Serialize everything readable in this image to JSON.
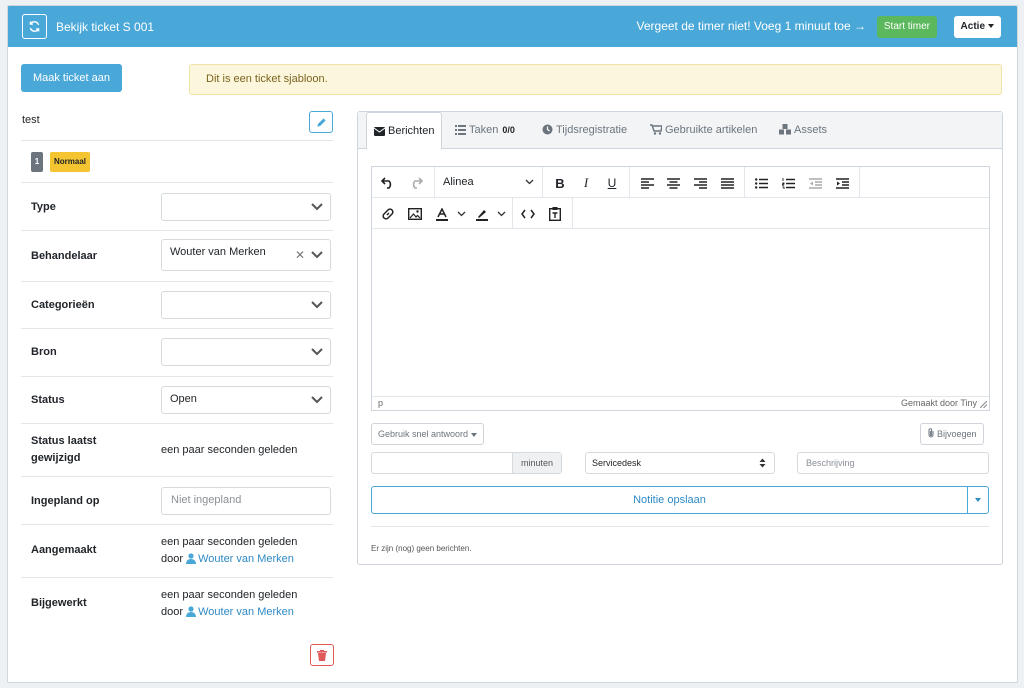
{
  "topbar": {
    "title": "Bekijk ticket S 001",
    "timer_message": "Vergeet de timer niet! Voeg 1 minuut toe →",
    "start_timer": "Start timer",
    "actie": "Actie"
  },
  "create_ticket": "Maak ticket aan",
  "alert": "Dit is een ticket sjabloon.",
  "ticket": {
    "name": "test",
    "number_badge": "1",
    "priority_badge": "Normaal"
  },
  "fields": {
    "type": {
      "label": "Type",
      "value": ""
    },
    "behandelaar": {
      "label": "Behandelaar",
      "value": "Wouter van Merken"
    },
    "categorieen": {
      "label": "Categorieën",
      "value": ""
    },
    "bron": {
      "label": "Bron",
      "value": ""
    },
    "status": {
      "label": "Status",
      "value": "Open"
    },
    "status_changed": {
      "label_1": "Status laatst",
      "label_2": "gewijzigd",
      "value": "een paar seconden geleden"
    },
    "ingepland": {
      "label": "Ingepland op",
      "placeholder": "Niet ingepland"
    },
    "aangemaakt": {
      "label": "Aangemaakt",
      "value": "een paar seconden geleden",
      "by": "door",
      "user": "Wouter van Merken"
    },
    "bijgewerkt": {
      "label": "Bijgewerkt",
      "value": "een paar seconden geleden",
      "by": "door",
      "user": "Wouter van Merken"
    }
  },
  "tabs": [
    {
      "label": "Berichten"
    },
    {
      "label": "Taken",
      "count": "0/0"
    },
    {
      "label": "Tijdsregistratie"
    },
    {
      "label": "Gebruikte artikelen"
    },
    {
      "label": "Assets"
    }
  ],
  "editor": {
    "block_format": "Alinea",
    "status_path": "p",
    "made_by": "Gemaakt door Tiny"
  },
  "quick_reply": "Gebruik snel antwoord",
  "attach": "Bijvoegen",
  "minutes_addon": "minuten",
  "department": "Servicedesk",
  "description_placeholder": "Beschrijving",
  "save_note": "Notitie opslaan",
  "no_messages": "Er zijn (nog) geen berichten.",
  "colors": {
    "primary": "#4aa8d8",
    "success": "#5cb85c",
    "warning": "#f5c431",
    "danger": "#e05a5a"
  }
}
